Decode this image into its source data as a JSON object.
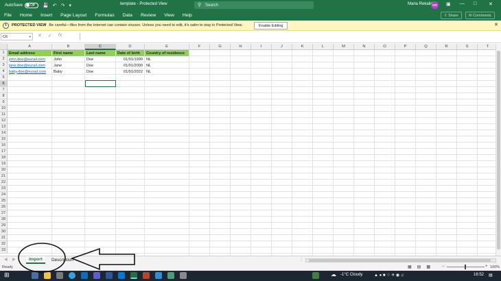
{
  "titlebar": {
    "autosave_label": "AutoSave",
    "autosave_state": "Off",
    "doc_title": "template - Protected View",
    "search_placeholder": "Search",
    "user_name": "Maria Rekalidou",
    "user_initials": "MR"
  },
  "menu": {
    "items": [
      "File",
      "Home",
      "Insert",
      "Page Layout",
      "Formulas",
      "Data",
      "Review",
      "View",
      "Help"
    ],
    "share_label": "Share",
    "comments_label": "Comments"
  },
  "protected_view": {
    "title": "PROTECTED VIEW",
    "message": "Be careful—files from the Internet can contain viruses. Unless you need to edit, it's safer to stay in Protected View.",
    "enable_label": "Enable Editing"
  },
  "formula_bar": {
    "name_box": "C6",
    "fx_label": "fx",
    "value": ""
  },
  "sheet": {
    "columns": [
      "A",
      "B",
      "C",
      "D",
      "E",
      "F",
      "G",
      "H",
      "I",
      "J",
      "K",
      "L",
      "M",
      "N",
      "O",
      "P",
      "Q",
      "R",
      "S",
      "T"
    ],
    "rows": [
      "1",
      "2",
      "3",
      "4",
      "5",
      "6",
      "7",
      "8",
      "9",
      "10",
      "11",
      "12",
      "13",
      "14",
      "15",
      "16",
      "17",
      "18",
      "19",
      "20",
      "21",
      "22",
      "23",
      "24",
      "25",
      "26",
      "27",
      "28",
      "29",
      "30",
      "31",
      "32",
      "33"
    ],
    "selected_cell": "C6",
    "header_row": [
      "Email address",
      "First name",
      "Last name",
      "Date of birth",
      "Country of residence"
    ],
    "data_rows": [
      [
        "john.doe@eurail.com",
        "John",
        "Doe",
        "01/01/1990",
        "NL"
      ],
      [
        "jane.doe@eurail.com",
        "Jane",
        "Doe",
        "01/01/2000",
        "NL"
      ],
      [
        "baby.doe@eurail.com",
        "Baby",
        "Doe",
        "01/01/2022",
        "NL"
      ]
    ],
    "header_fill": "#92d050",
    "link_color": "#0563c1"
  },
  "sheet_tabs": {
    "tabs": [
      "Import",
      "Description"
    ],
    "active": "Import"
  },
  "status": {
    "ready": "Ready",
    "zoom": "100%"
  },
  "taskbar": {
    "weather": "-1°C  Cloudy",
    "time": "16:52"
  },
  "colors": {
    "excel_green": "#217346",
    "protected_bg": "#fdf6c4"
  }
}
